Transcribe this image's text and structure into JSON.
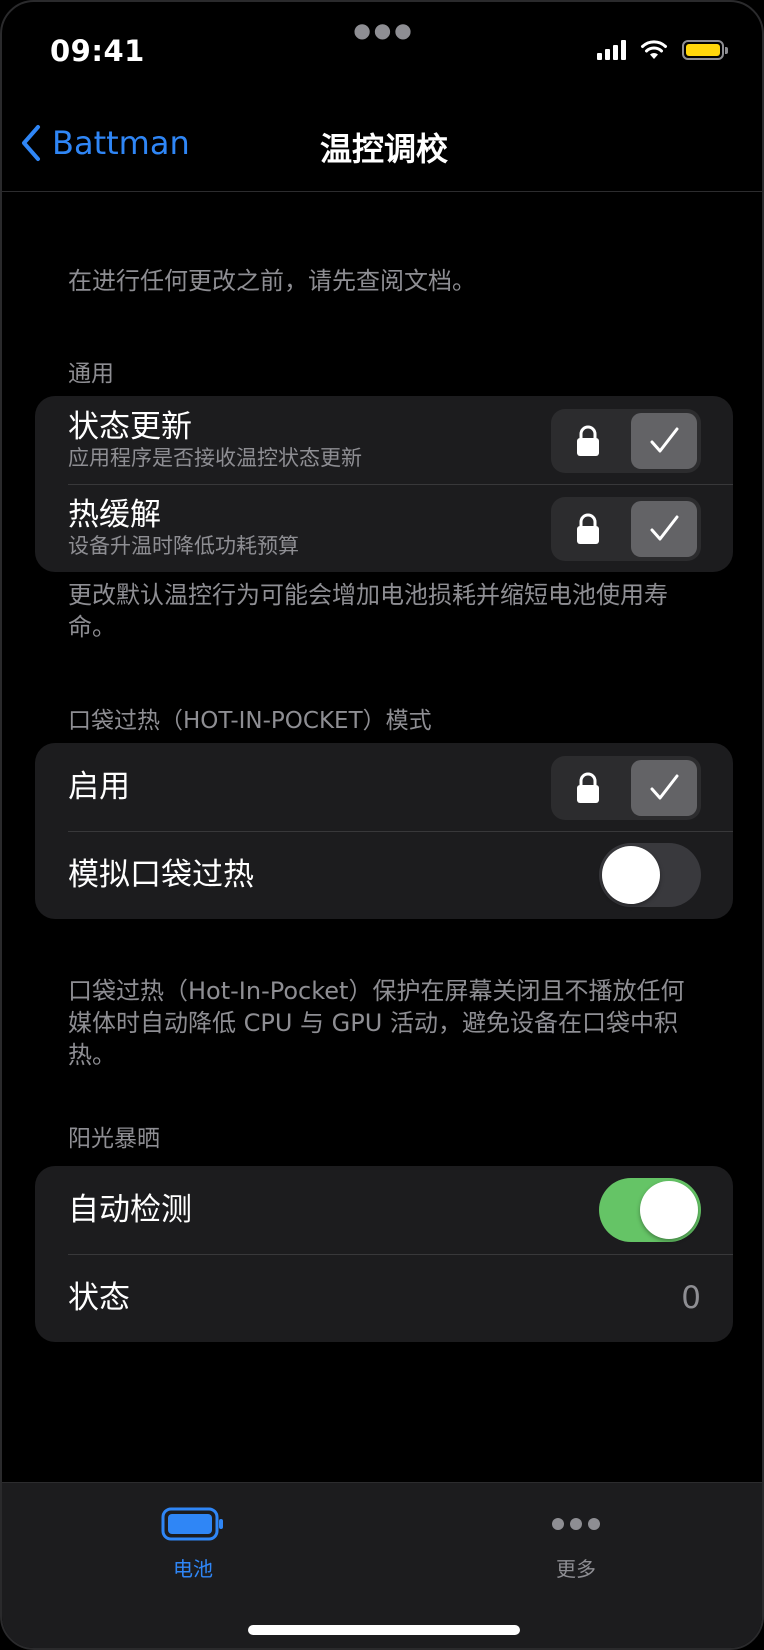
{
  "status_bar": {
    "time": "09:41"
  },
  "nav": {
    "back_label": "Battman",
    "title": "温控调校"
  },
  "intro_note": "在进行任何更改之前，请先查阅文档。",
  "general": {
    "header": "通用",
    "rows": [
      {
        "title": "状态更新",
        "subtitle": "应用程序是否接收温控状态更新",
        "locked": true,
        "checked": true
      },
      {
        "title": "热缓解",
        "subtitle": "设备升温时降低功耗预算",
        "locked": true,
        "checked": true
      }
    ],
    "footer": "更改默认温控行为可能会增加电池损耗并缩短电池使用寿命。"
  },
  "hip": {
    "header": "口袋过热（HOT-IN-POCKET）模式",
    "rows": [
      {
        "title": "启用",
        "locked": true,
        "checked": true
      },
      {
        "title": "模拟口袋过热",
        "toggle_on": false
      }
    ],
    "footer": "口袋过热（Hot-In-Pocket）保护在屏幕关闭且不播放任何媒体时自动降低 CPU 与 GPU 活动，避免设备在口袋中积热。"
  },
  "sunlight": {
    "header": "阳光暴晒",
    "rows": [
      {
        "title": "自动检测",
        "toggle_on": true
      },
      {
        "title": "状态",
        "value": "0"
      }
    ]
  },
  "tabbar": {
    "tabs": [
      {
        "label": "电池",
        "icon": "battery-icon",
        "selected": true
      },
      {
        "label": "更多",
        "icon": "more-icon",
        "selected": false
      }
    ]
  },
  "colors": {
    "accent": "#2f86f6",
    "toggle_on": "#65c466",
    "battery_status": "#ffd60a"
  }
}
